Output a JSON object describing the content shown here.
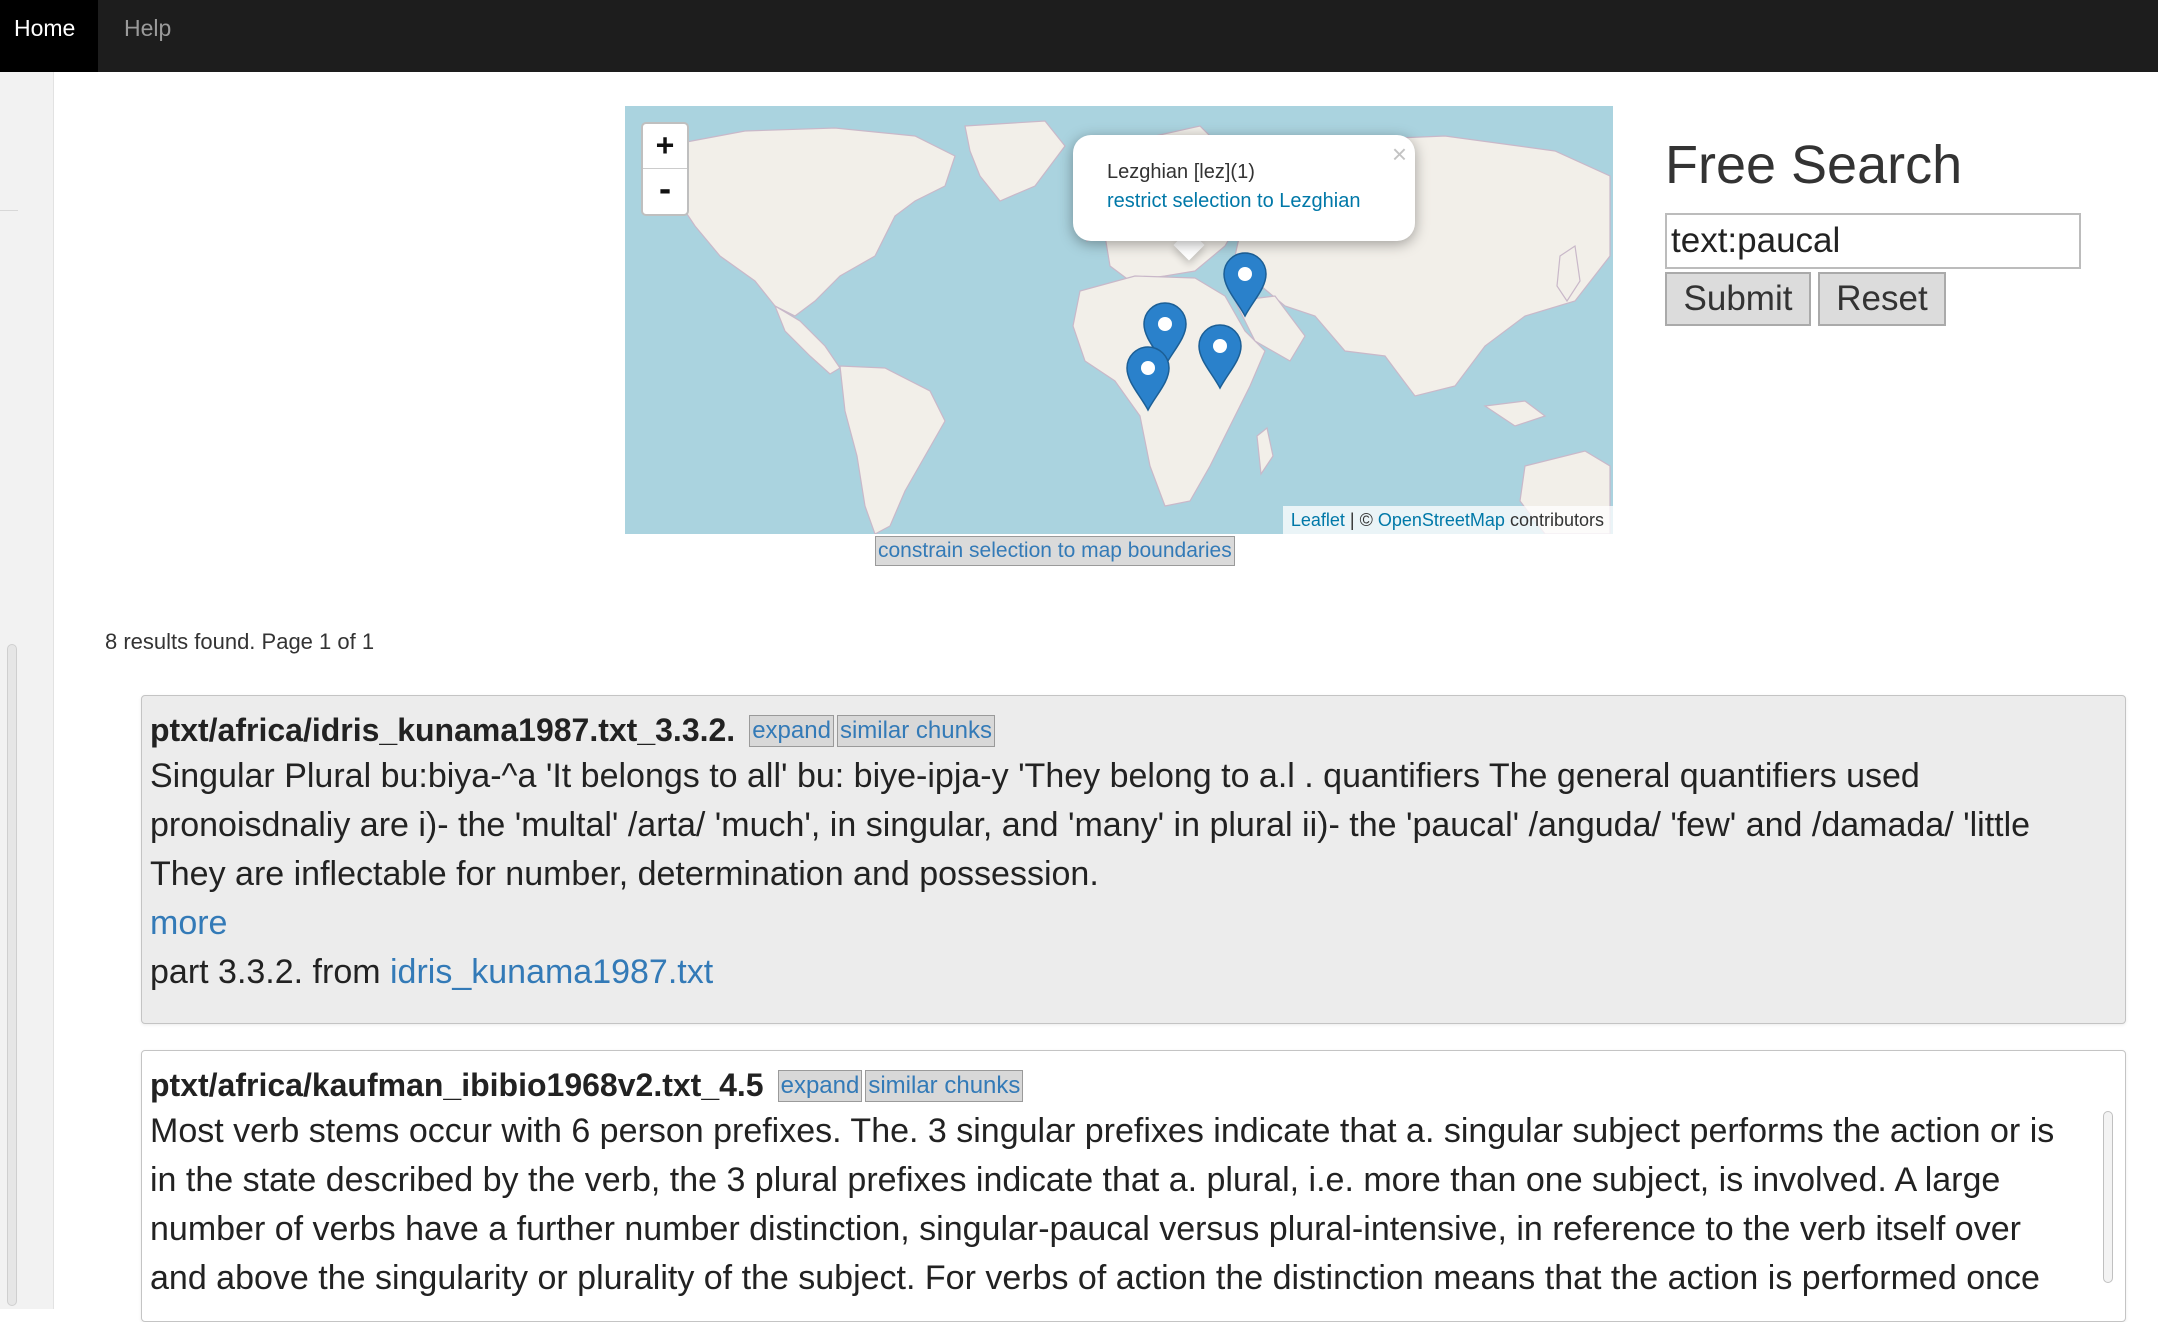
{
  "nav": {
    "home": "Home",
    "help": "Help"
  },
  "map": {
    "zoom_in": "+",
    "zoom_out": "-",
    "popup": {
      "text": "Lezghian [lez](1)",
      "link": "restrict selection to Lezghian",
      "close": "×"
    },
    "attribution": {
      "leaflet": "Leaflet",
      "sep": " | © ",
      "osm": "OpenStreetMap",
      "rest": " contributors"
    },
    "constrain_button": "constrain selection to map boundaries",
    "marker_color": "#2a81cb"
  },
  "search": {
    "title": "Free Search",
    "value": "text:paucal",
    "submit": "Submit",
    "reset": "Reset"
  },
  "results_count": "8 results found. Page 1 of 1",
  "results": [
    {
      "title": "ptxt/africa/idris_kunama1987.txt_3.3.2.",
      "expand": "expand",
      "similar": "similar chunks",
      "text": "Singular Plural bu:biya-^a 'It belongs to all' bu: biye-ipja-y 'They belong to a.l . quantifiers The general quantifiers used pronoisdnaliy are i)- the 'multal' /arta/ 'much', in singular, and 'many' in plural ii)- the 'paucal' /anguda/ 'few' and /damada/ 'little They are inflectable for number, determination and possession.",
      "more": "more",
      "part_prefix": "part 3.3.2. from ",
      "file": "idris_kunama1987.txt"
    },
    {
      "title": "ptxt/africa/kaufman_ibibio1968v2.txt_4.5",
      "expand": "expand",
      "similar": "similar chunks",
      "text": "Most verb stems occur with 6 person prefixes. The. 3 singular prefixes indicate that a. singular subject performs the action or is in the state described by the verb, the 3 plural prefixes indicate that a. plural, i.e. more than one subject, is involved. A large number of verbs have a further number distinction, singular-paucal versus plural-intensive, in reference to the verb itself over and above the singularity or plurality of the subject. For verbs of action the distinction means that the action is performed once"
    }
  ]
}
